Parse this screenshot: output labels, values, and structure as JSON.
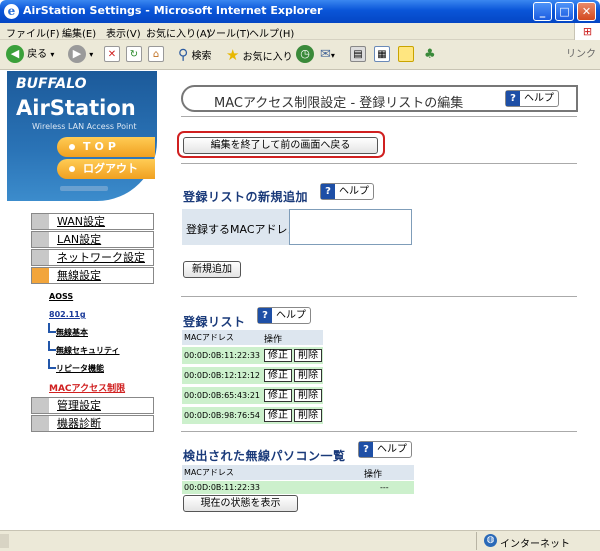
{
  "window": {
    "title": "AirStation Settings - Microsoft Internet Explorer",
    "buttons": {
      "minimize": "_",
      "maximize": "□",
      "close": "✕"
    }
  },
  "menu": [
    "ファイル(F)",
    "編集(E)",
    "表示(V)",
    "お気に入り(A)",
    "ツール(T)",
    "ヘルプ(H)"
  ],
  "toolbar": {
    "back": "戻る",
    "search": "検索",
    "favorites": "お気に入り",
    "links": "リンク"
  },
  "sidebar": {
    "brand": "BUFFALO",
    "product": "AirStation",
    "tagline": "Wireless LAN Access Point",
    "top_button": "TOP",
    "logout_button": "ログアウト",
    "nav": [
      {
        "label": "WAN設定",
        "active": false
      },
      {
        "label": "LAN設定",
        "active": false
      },
      {
        "label": "ネットワーク設定",
        "active": false
      },
      {
        "label": "無線設定",
        "active": true
      }
    ],
    "wireless_sub": {
      "aoss": "AOSS",
      "dot11g": "802.11g",
      "basic": "無線基本",
      "security": "無線セキュリティ",
      "repeater": "リピータ機能",
      "mac": "MACアクセス制限"
    },
    "nav_bottom": [
      {
        "label": "管理設定"
      },
      {
        "label": "機器診断"
      }
    ]
  },
  "main": {
    "page_title": "MACアクセス制限設定 - 登録リストの編集",
    "help_label": "ヘルプ",
    "back_button": "編集を終了して前の画面へ戻る",
    "add_section": {
      "title": "登録リストの新規追加",
      "field_label": "登録するMACアドレス",
      "field_value": "",
      "add_button": "新規追加"
    },
    "list_section": {
      "title": "登録リスト",
      "headers": {
        "mac": "MACアドレス",
        "op": "操作"
      },
      "rows": [
        {
          "mac": "00:0D:0B:11:22:33",
          "edit": "修正",
          "delete": "削除"
        },
        {
          "mac": "00:0D:0B:12:12:12",
          "edit": "修正",
          "delete": "削除"
        },
        {
          "mac": "00:0D:0B:65:43:21",
          "edit": "修正",
          "delete": "削除"
        },
        {
          "mac": "00:0D:0B:98:76:54",
          "edit": "修正",
          "delete": "削除"
        }
      ]
    },
    "detected_section": {
      "title": "検出された無線パソコン一覧",
      "headers": {
        "mac": "MACアドレス",
        "op": "操作"
      },
      "rows": [
        {
          "mac": "00:0D:0B:11:22:33",
          "op": "---"
        }
      ],
      "refresh_button": "現在の状態を表示"
    }
  },
  "status": {
    "zone": "インターネット"
  },
  "colors": {
    "titlebar": "#0a55d8",
    "highlight_outline": "#d02020",
    "table_header": "#dde6ef",
    "table_row": "#ccf0cc",
    "sidebar_blue": "#2a73b6",
    "accent_orange": "#f0a020"
  }
}
